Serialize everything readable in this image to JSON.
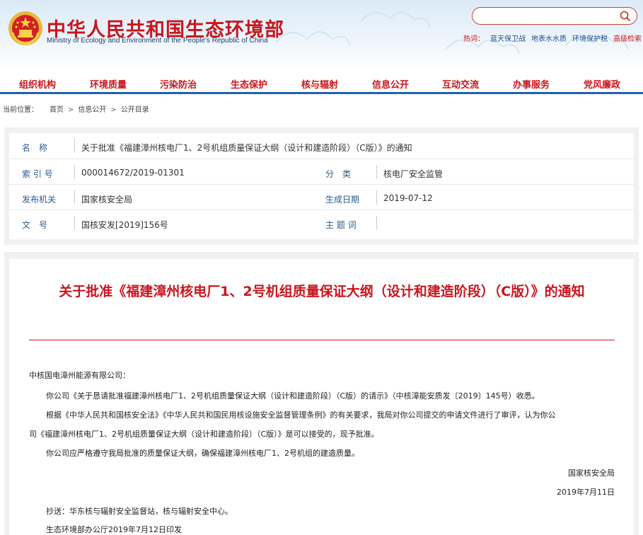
{
  "header": {
    "title_cn": "中华人民共和国生态环境部",
    "title_en": "Ministry of Ecology and Environment of the People's Republic of China",
    "search_placeholder": "",
    "hot_label": "热词：",
    "hot_words": [
      "蓝天保卫战",
      "地表水水质",
      "环境保护税",
      "高级检索"
    ]
  },
  "nav": {
    "items": [
      "组织机构",
      "环境质量",
      "污染防治",
      "生态保护",
      "核与辐射",
      "信息公开",
      "互动交流",
      "办事服务",
      "党风廉政"
    ]
  },
  "breadcrumb": {
    "label": "当前位置：",
    "items": [
      "首页",
      "信息公开",
      "公开目录"
    ],
    "separator": ">"
  },
  "meta": {
    "name_label": "名　称",
    "name_value": "关于批准《福建漳州核电厂1、2号机组质量保证大纲（设计和建造阶段）（C版）》的通知",
    "index_label": "索 引 号",
    "index_value": "000014672/2019-01301",
    "category_label": "分　类",
    "category_value": "核电厂安全监管",
    "issuer_label": "发布机关",
    "issuer_value": "国家核安全局",
    "date_label": "生成日期",
    "date_value": "2019-07-12",
    "docno_label": "文　号",
    "docno_value": "国核安发[2019]156号",
    "subject_label": "主 题 词",
    "subject_value": ""
  },
  "document": {
    "title": "关于批准《福建漳州核电厂1、2号机组质量保证大纲（设计和建造阶段）（C版）》的通知",
    "addressee": "中核国电漳州能源有限公司：",
    "p1": "你公司《关于恳请批准福建漳州核电厂1、2号机组质量保证大纲（设计和建造阶段）（C版）的请示》（中核漳能安质发〔2019〕145号）收悉。",
    "p2_line1": "根据《中华人民共和国核安全法》《中华人民共和国民用核设施安全监督管理条例》的有关要求，我局对你公司提交的申请文件进行了审评，认为你公",
    "p2_line2": "司《福建漳州核电厂1、2号机组质量保证大纲（设计和建造阶段）（C版）》是可以接受的，现予批准。",
    "p3": "你公司应严格遵守我局批准的质量保证大纲，确保福建漳州核电厂1、2号机组的建造质量。",
    "signer": "国家核安全局",
    "sign_date": "2019年7月11日",
    "cc": "抄送：华东核与辐射安全监督站，核与辐射安全中心。",
    "printed": "生态环境部办公厅2019年7月12日印发"
  },
  "colors": {
    "brand_red": "#c8161d",
    "nav_blue": "#1f63ab",
    "label_blue": "#2a5a8c"
  }
}
